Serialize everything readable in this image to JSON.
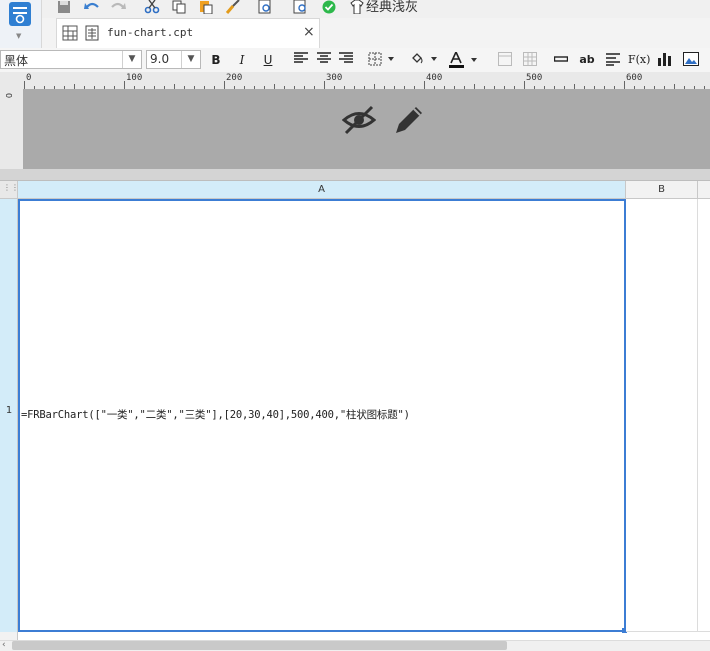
{
  "toolbar": {
    "theme_label": "经典浅灰",
    "icons": [
      "template-icon",
      "save-icon",
      "undo-icon",
      "redo-icon",
      "cut-icon",
      "copy-icon",
      "paste-icon",
      "format-painter-icon",
      "preview-icon",
      "search-icon",
      "check-icon",
      "theme-icon"
    ]
  },
  "tabs": [
    {
      "label": "fun-chart.cpt"
    }
  ],
  "format": {
    "font_name": "黑体",
    "font_size": "9.0",
    "bold": "B",
    "italic": "I",
    "underline": "U",
    "text_wrap": "ab",
    "formula": "F(x)"
  },
  "ruler": {
    "marks": [
      "0",
      "100",
      "200",
      "300",
      "400",
      "500",
      "600"
    ]
  },
  "grid": {
    "columns": [
      "A",
      "B"
    ],
    "rows": [
      "1"
    ],
    "cell_a1": "=FRBarChart([\"一类\",\"二类\",\"三类\"],[20,30,40],500,400,\"柱状图标题\")"
  },
  "colors": {
    "accent": "#3c7dd4",
    "header_selected": "#d3ecf9",
    "preview_bg": "#aaaaaa"
  }
}
